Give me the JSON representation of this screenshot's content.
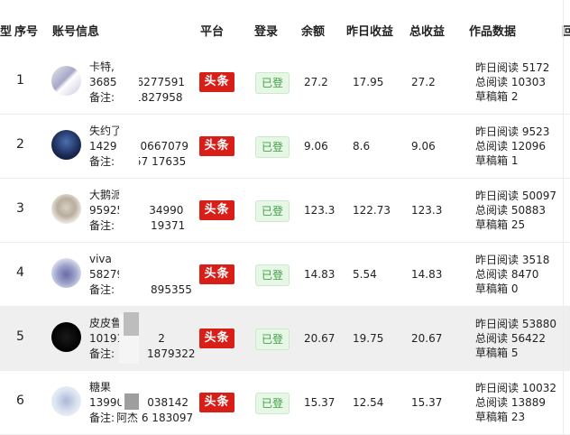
{
  "header": {
    "left_edge": "型",
    "index": "序号",
    "account": "账号信息",
    "platform": "平台",
    "login": "登录",
    "balance": "余额",
    "yesterday": "昨日收益",
    "total": "总收益",
    "works": "作品数据",
    "right_edge": "回"
  },
  "rows": [
    {
      "index": "1",
      "name": "卡特,",
      "line2": "3685",
      "line2b": "6277591",
      "line3": "备注:",
      "line3b": "1827958",
      "platform": "头条",
      "login": "已登",
      "balance": "27.2",
      "yesterday": "17.95",
      "total": "27.2",
      "w1": "昨日阅读 5172",
      "w2": "总阅读 10303",
      "w3": "草稿箱 2"
    },
    {
      "index": "2",
      "name": "失约了",
      "line2": "1429",
      "line2b": "0667079",
      "line3": "备注:",
      "line3b": "57 17635",
      "platform": "头条",
      "login": "已登",
      "balance": "9.06",
      "yesterday": "8.6",
      "total": "9.06",
      "w1": "昨日阅读 9523",
      "w2": "总阅读 12096",
      "w3": "草稿箱 1"
    },
    {
      "index": "3",
      "name": "大鹅派",
      "line2": "95925",
      "line2b": "34990",
      "line3": "备注:",
      "line3b": "19371",
      "platform": "头条",
      "login": "已登",
      "balance": "123.3",
      "yesterday": "122.73",
      "total": "123.3",
      "w1": "昨日阅读 50097",
      "w2": "总阅读 50883",
      "w3": "草稿箱 25"
    },
    {
      "index": "4",
      "name": "viva",
      "line2": "58279",
      "line2b": "",
      "line3": "备注:",
      "line3b": "895355",
      "platform": "头条",
      "login": "已登",
      "balance": "14.83",
      "yesterday": "5.54",
      "total": "14.83",
      "w1": "昨日阅读 3518",
      "w2": "总阅读 8470",
      "w3": "草稿箱 0"
    },
    {
      "index": "5",
      "name": "皮皮鲁",
      "line2": "10191",
      "line2b": "2",
      "line3": "备注:",
      "line3b": "1879322",
      "platform": "头条",
      "login": "已登",
      "balance": "20.67",
      "yesterday": "19.75",
      "total": "20.67",
      "w1": "昨日阅读 53880",
      "w2": "总阅读 56422",
      "w3": "草稿箱 5"
    },
    {
      "index": "6",
      "name": "糖果",
      "line2": "13990",
      "line2b": "038142",
      "line3": "备注:",
      "line3b": "阿杰 6 183097",
      "platform": "头条",
      "login": "已登",
      "balance": "15.37",
      "yesterday": "12.54",
      "total": "15.37",
      "w1": "昨日阅读 10032",
      "w2": "总阅读 13889",
      "w3": "草稿箱 23"
    }
  ]
}
